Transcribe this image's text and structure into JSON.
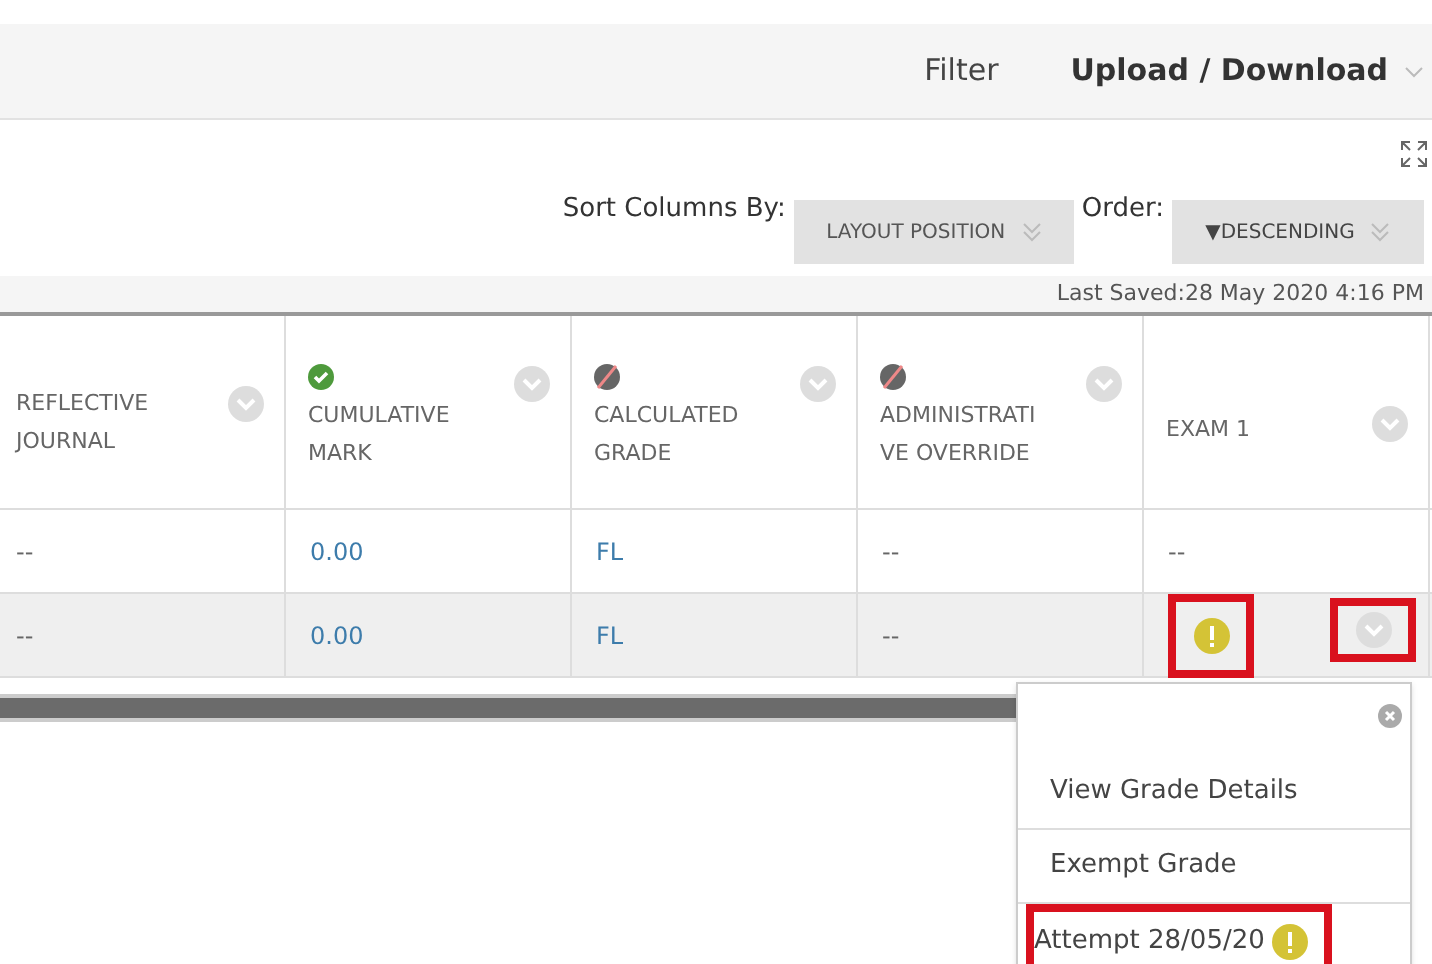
{
  "toolbar": {
    "filter": "Filter",
    "upload_download": "Upload / Download"
  },
  "sort": {
    "label": "Sort Columns By:",
    "value": "LAYOUT POSITION",
    "order_label": "Order:",
    "order_value": "▼DESCENDING"
  },
  "last_saved": "Last Saved:28 May 2020 4:16 PM",
  "columns": [
    {
      "label": "REFLECTIVE JOURNAL"
    },
    {
      "label": "CUMULATIVE MARK",
      "released": true
    },
    {
      "label": "CALCULATED GRADE",
      "released": false
    },
    {
      "label": "ADMINISTRATI VE OVERRIDE",
      "released": false
    },
    {
      "label": "EXAM 1"
    }
  ],
  "rows": [
    {
      "selected": false,
      "cells": [
        {
          "kind": "text",
          "text": "--"
        },
        {
          "kind": "link",
          "text": "0.00"
        },
        {
          "kind": "link",
          "text": "FL"
        },
        {
          "kind": "text",
          "text": "--"
        },
        {
          "kind": "text",
          "text": "--"
        }
      ]
    },
    {
      "selected": true,
      "cells": [
        {
          "kind": "text",
          "text": "--"
        },
        {
          "kind": "link",
          "text": "0.00"
        },
        {
          "kind": "link",
          "text": "FL"
        },
        {
          "kind": "text",
          "text": "--"
        },
        {
          "kind": "attempt",
          "highlighted": true,
          "menu_highlighted": true
        }
      ]
    }
  ],
  "menu": {
    "items": [
      {
        "text": "View Grade Details",
        "highlighted": false,
        "kind": "plain"
      },
      {
        "text": "Exempt Grade",
        "highlighted": false,
        "kind": "plain"
      },
      {
        "text": "Attempt 28/05/20",
        "highlighted": true,
        "kind": "attempt"
      }
    ]
  }
}
